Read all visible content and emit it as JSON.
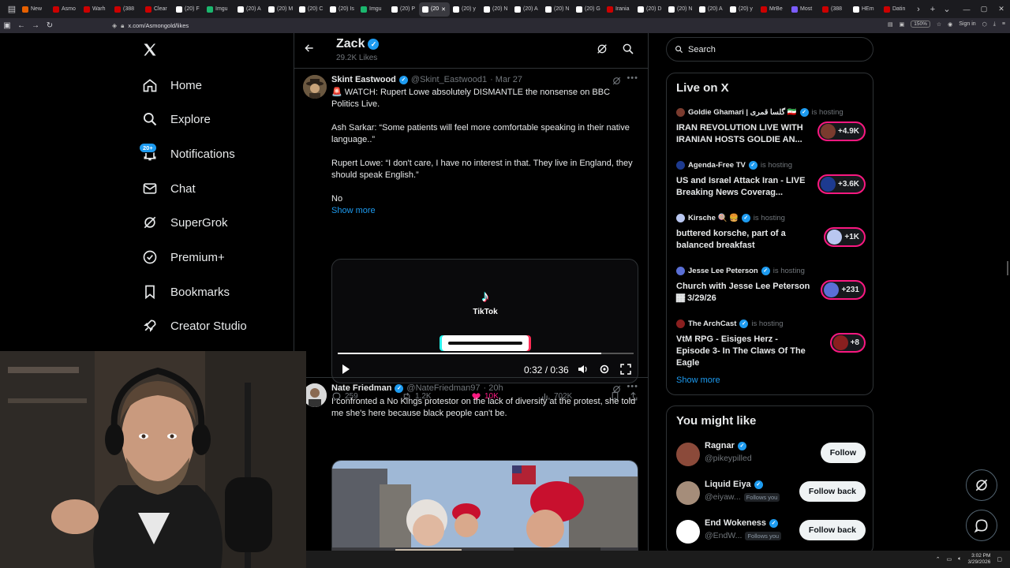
{
  "browser": {
    "tabs": [
      {
        "label": "New",
        "color": "#e66000"
      },
      {
        "label": "Asmo",
        "color": "#cc0000"
      },
      {
        "label": "Warh",
        "color": "#cc0000"
      },
      {
        "label": "(388",
        "color": "#cc0000"
      },
      {
        "label": "Clear",
        "color": "#cc0000"
      },
      {
        "label": "(20) F",
        "color": "#ffffff"
      },
      {
        "label": "Imgu",
        "color": "#1bb76e"
      },
      {
        "label": "(20) A",
        "color": "#ffffff"
      },
      {
        "label": "(20) M",
        "color": "#ffffff"
      },
      {
        "label": "(20) C",
        "color": "#ffffff"
      },
      {
        "label": "(20) Is",
        "color": "#ffffff"
      },
      {
        "label": "Imgu",
        "color": "#1bb76e"
      },
      {
        "label": "(20) P",
        "color": "#ffffff"
      },
      {
        "label": "(20",
        "color": "#ffffff",
        "active": true
      },
      {
        "label": "(20) y",
        "color": "#ffffff"
      },
      {
        "label": "(20) N",
        "color": "#ffffff"
      },
      {
        "label": "(20) A",
        "color": "#ffffff"
      },
      {
        "label": "(20) N",
        "color": "#ffffff"
      },
      {
        "label": "(20) G",
        "color": "#ffffff"
      },
      {
        "label": "Irania",
        "color": "#cc0000"
      },
      {
        "label": "(20) D",
        "color": "#ffffff"
      },
      {
        "label": "(20) N",
        "color": "#ffffff"
      },
      {
        "label": "(20) A",
        "color": "#ffffff"
      },
      {
        "label": "(20) y",
        "color": "#ffffff"
      },
      {
        "label": "MrBe",
        "color": "#cc0000"
      },
      {
        "label": "Most",
        "color": "#7b5cff"
      },
      {
        "label": "(388",
        "color": "#cc0000"
      },
      {
        "label": "HEm",
        "color": "#ffffff"
      },
      {
        "label": "Datin",
        "color": "#cc0000"
      }
    ],
    "url": "x.com/Asmongold/likes",
    "zoom": "150%",
    "sign_in": "Sign in"
  },
  "nav": {
    "items": [
      {
        "label": "Home",
        "icon": "home-icon"
      },
      {
        "label": "Explore",
        "icon": "search-icon"
      },
      {
        "label": "Notifications",
        "icon": "bell-icon"
      },
      {
        "label": "Chat",
        "icon": "mail-icon"
      },
      {
        "label": "SuperGrok",
        "icon": "grok-icon"
      },
      {
        "label": "Premium+",
        "icon": "verified-icon"
      },
      {
        "label": "Bookmarks",
        "icon": "bookmark-icon"
      },
      {
        "label": "Creator Studio",
        "icon": "rocket-icon"
      }
    ],
    "notif_count": "20+"
  },
  "profile": {
    "name": "Zack",
    "likes": "29.2K Likes"
  },
  "tweets": [
    {
      "name": "Skint Eastwood",
      "handle": "@Skint_Eastwood1",
      "time": "· Mar 27",
      "text": "🚨 WATCH: Rupert Lowe absolutely DISMANTLE the nonsense on BBC Politics Live.\n\nAsh Sarkar: “Some patients will feel more comfortable speaking in their native language..”\n\nRupert Lowe: “I don't care, I have no interest in that. They live in England, they should speak English.”\n\nNo",
      "show_more": "Show more",
      "video": {
        "brand": "TikTok",
        "time": "0:32 / 0:36",
        "progress": 0.89
      },
      "replies": "259",
      "reposts": "1.2K",
      "likes": "10K",
      "views": "702K"
    },
    {
      "name": "Nate Friedman",
      "handle": "@NateFriedman97",
      "time": "· 20h",
      "text": "I confronted a No Kings protestor on the lack of diversity at the protest, she told me she's here because black people can't be."
    }
  ],
  "search": {
    "placeholder": "Search"
  },
  "live": {
    "title": "Live on X",
    "hosting_label": "is hosting",
    "items": [
      {
        "host": "Goldie Ghamari | گلسا قمری 🇮🇷",
        "title": "IRAN REVOLUTION LIVE WITH IRANIAN HOSTS GOLDIE AN...",
        "count": "+4.9K",
        "color": "#7a3b2e"
      },
      {
        "host": "Agenda-Free TV",
        "title": "US and Israel Attack Iran - LIVE Breaking News Coverag...",
        "count": "+3.6K",
        "color": "#1d3a8f"
      },
      {
        "host": "Kirsche 🍭 🍔",
        "title": "buttered korsche, part of a balanced breakfast",
        "count": "+1K",
        "color": "#b9c7f0"
      },
      {
        "host": "Jesse Lee Peterson",
        "title": "Church with Jesse Lee Peterson 🏾 3/29/26",
        "count": "+231",
        "color": "#5a6fd6"
      },
      {
        "host": "The ArchCast",
        "title": "VtM RPG - Eisiges Herz  - Episode 3- In The Claws Of The Eagle",
        "count": "+8",
        "color": "#8a1f1f"
      }
    ],
    "show_more": "Show more"
  },
  "suggest": {
    "title": "You might like",
    "follows_you": "Follows you",
    "items": [
      {
        "name": "Ragnar",
        "handle": "@pikeypilled",
        "button": "Follow",
        "follows_you": false,
        "color": "#8b4a3a"
      },
      {
        "name": "Liquid Eiya",
        "handle": "@eiyaw...",
        "button": "Follow back",
        "follows_you": true,
        "color": "#a58d7a"
      },
      {
        "name": "End Wokeness",
        "handle": "@EndW...",
        "button": "Follow back",
        "follows_you": true,
        "color": "#ffffff"
      }
    ]
  },
  "taskbar": {
    "time": "3:02 PM",
    "date": "3/29/2026"
  }
}
